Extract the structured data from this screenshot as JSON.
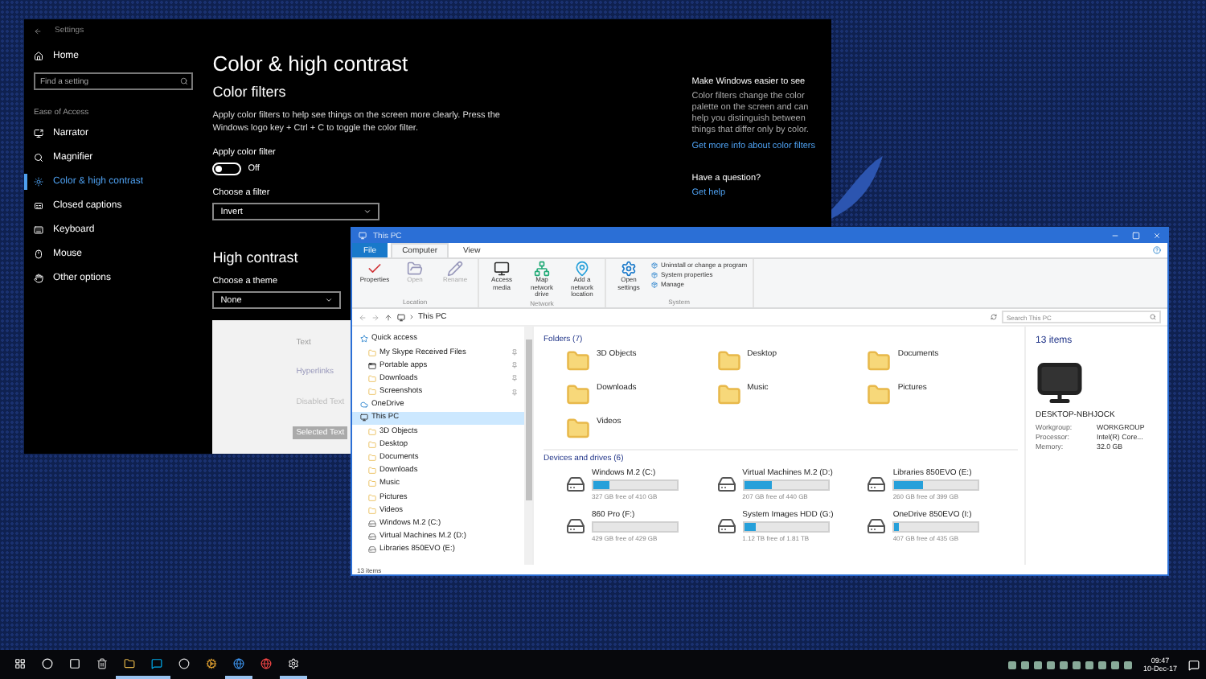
{
  "settings_window": {
    "title": "Settings",
    "home": "Home",
    "search_placeholder": "Find a setting",
    "section": "Ease of Access",
    "nav": [
      {
        "label": "Narrator",
        "kind": "narrator",
        "selected": false
      },
      {
        "label": "Magnifier",
        "kind": "magnifier",
        "selected": false
      },
      {
        "label": "Color & high contrast",
        "kind": "color",
        "selected": true
      },
      {
        "label": "Closed captions",
        "kind": "captions",
        "selected": false
      },
      {
        "label": "Keyboard",
        "kind": "keyboard",
        "selected": false
      },
      {
        "label": "Mouse",
        "kind": "mouse",
        "selected": false
      },
      {
        "label": "Other options",
        "kind": "other",
        "selected": false
      }
    ],
    "page_title": "Color & high contrast",
    "color_filters": {
      "heading": "Color filters",
      "description": "Apply color filters to help see things on the screen more clearly. Press the Windows logo key + Ctrl + C to toggle the color filter.",
      "toggle_label": "Apply color filter",
      "toggle_on": false,
      "toggle_text": "Off",
      "filter_label": "Choose a filter",
      "filter_value": "Invert"
    },
    "high_contrast": {
      "heading": "High contrast",
      "theme_label": "Choose a theme",
      "theme_value": "None",
      "preview": [
        {
          "label": "Text",
          "kind": "text"
        },
        {
          "label": "Hyperlinks",
          "kind": "hyperlink"
        },
        {
          "label": "Disabled Text",
          "kind": "disabled"
        },
        {
          "label": "Selected Text",
          "kind": "selected"
        }
      ]
    },
    "aside": {
      "heading": "Make Windows easier to see",
      "text": "Color filters change the color palette on the screen and can help you distinguish between things that differ only by color.",
      "link": "Get more info about color filters",
      "question": "Have a question?",
      "help": "Get help"
    }
  },
  "explorer": {
    "title": "This PC",
    "tabs": [
      {
        "label": "File",
        "kind": "file",
        "selected": false
      },
      {
        "label": "Computer",
        "kind": "tab",
        "selected": true
      },
      {
        "label": "View",
        "kind": "tab",
        "selected": false
      }
    ],
    "ribbon": [
      {
        "label": "Location",
        "items": [
          {
            "label": "Properties",
            "kind": "check",
            "disabled": false
          },
          {
            "label": "Open",
            "kind": "open",
            "disabled": true
          },
          {
            "label": "Rename",
            "kind": "rename",
            "disabled": true
          }
        ]
      },
      {
        "label": "Network",
        "items": [
          {
            "label": "Access media",
            "kind": "media",
            "disabled": false
          },
          {
            "label": "Map network drive",
            "kind": "map",
            "disabled": false
          },
          {
            "label": "Add a network location",
            "kind": "location",
            "disabled": false
          }
        ]
      },
      {
        "label": "System",
        "items": [
          {
            "label": "Open settings",
            "kind": "settings",
            "disabled": false
          }
        ],
        "small": [
          "Uninstall or change a program",
          "System properties",
          "Manage"
        ]
      }
    ],
    "address": "This PC",
    "search_placeholder": "Search This PC",
    "nav": [
      {
        "label": "Quick access",
        "kind": "star",
        "selected": false,
        "children": [
          {
            "label": "My Skype Received Files",
            "kind": "folder",
            "pinned": true,
            "selected": false
          },
          {
            "label": "Portable apps",
            "kind": "app",
            "pinned": true,
            "selected": false
          },
          {
            "label": "Downloads",
            "kind": "folder",
            "pinned": true,
            "selected": false
          },
          {
            "label": "Screenshots",
            "kind": "folder",
            "pinned": true,
            "selected": false
          }
        ]
      },
      {
        "label": "OneDrive",
        "kind": "cloud",
        "selected": false
      },
      {
        "label": "This PC",
        "kind": "pc",
        "selected": true,
        "children": [
          {
            "label": "3D Objects",
            "kind": "folder",
            "pinned": false,
            "selected": false
          },
          {
            "label": "Desktop",
            "kind": "folder",
            "pinned": false,
            "selected": false
          },
          {
            "label": "Documents",
            "kind": "folder",
            "pinned": false,
            "selected": false
          },
          {
            "label": "Downloads",
            "kind": "folder",
            "pinned": false,
            "selected": false
          },
          {
            "label": "Music",
            "kind": "folder",
            "pinned": false,
            "selected": false
          },
          {
            "label": "Pictures",
            "kind": "folder",
            "pinned": false,
            "selected": false
          },
          {
            "label": "Videos",
            "kind": "folder",
            "pinned": false,
            "selected": false
          },
          {
            "label": "Windows M.2 (C:)",
            "kind": "drive",
            "pinned": false,
            "selected": false
          },
          {
            "label": "Virtual Machines M.2 (D:)",
            "kind": "drive",
            "pinned": false,
            "selected": false
          },
          {
            "label": "Libraries 850EVO (E:)",
            "kind": "drive",
            "pinned": false,
            "selected": false
          }
        ]
      }
    ],
    "folders_heading": "Folders (7)",
    "folders": [
      "3D Objects",
      "Desktop",
      "Documents",
      "Downloads",
      "Music",
      "Pictures",
      "Videos"
    ],
    "drives_heading": "Devices and drives (6)",
    "drives": [
      {
        "name": "Windows M.2 (C:)",
        "free": "327 GB free of 410 GB",
        "level": 0.2
      },
      {
        "name": "Virtual Machines M.2 (D:)",
        "free": "207 GB free of 440 GB",
        "level": 0.33
      },
      {
        "name": "Libraries 850EVO (E:)",
        "free": "260 GB free of 399 GB",
        "level": 0.34
      },
      {
        "name": "860 Pro (F:)",
        "free": "429 GB free of 429 GB",
        "level": 0
      },
      {
        "name": "System Images HDD (G:)",
        "free": "1.12 TB free of 1.81 TB",
        "level": 0.15
      },
      {
        "name": "OneDrive 850EVO (I:)",
        "free": "407 GB free of 435 GB",
        "level": 0.06
      }
    ],
    "details": {
      "count": "13 items",
      "computer": "DESKTOP-NBHJOCK",
      "rows": [
        {
          "key": "Workgroup:",
          "value": "WORKGROUP"
        },
        {
          "key": "Processor:",
          "value": "Intel(R) Core..."
        },
        {
          "key": "Memory:",
          "value": "32.0 GB"
        }
      ]
    },
    "status": "13 items"
  },
  "taskbar": {
    "apps": [
      {
        "kind": "explorer",
        "active": true
      },
      {
        "kind": "skype",
        "active": true
      },
      {
        "kind": "media",
        "active": false
      },
      {
        "kind": "tool",
        "active": false
      },
      {
        "kind": "edge",
        "active": true
      },
      {
        "kind": "chrome",
        "active": false
      },
      {
        "kind": "settings",
        "active": true
      }
    ],
    "time": "09:47",
    "date": "10-Dec-17"
  }
}
